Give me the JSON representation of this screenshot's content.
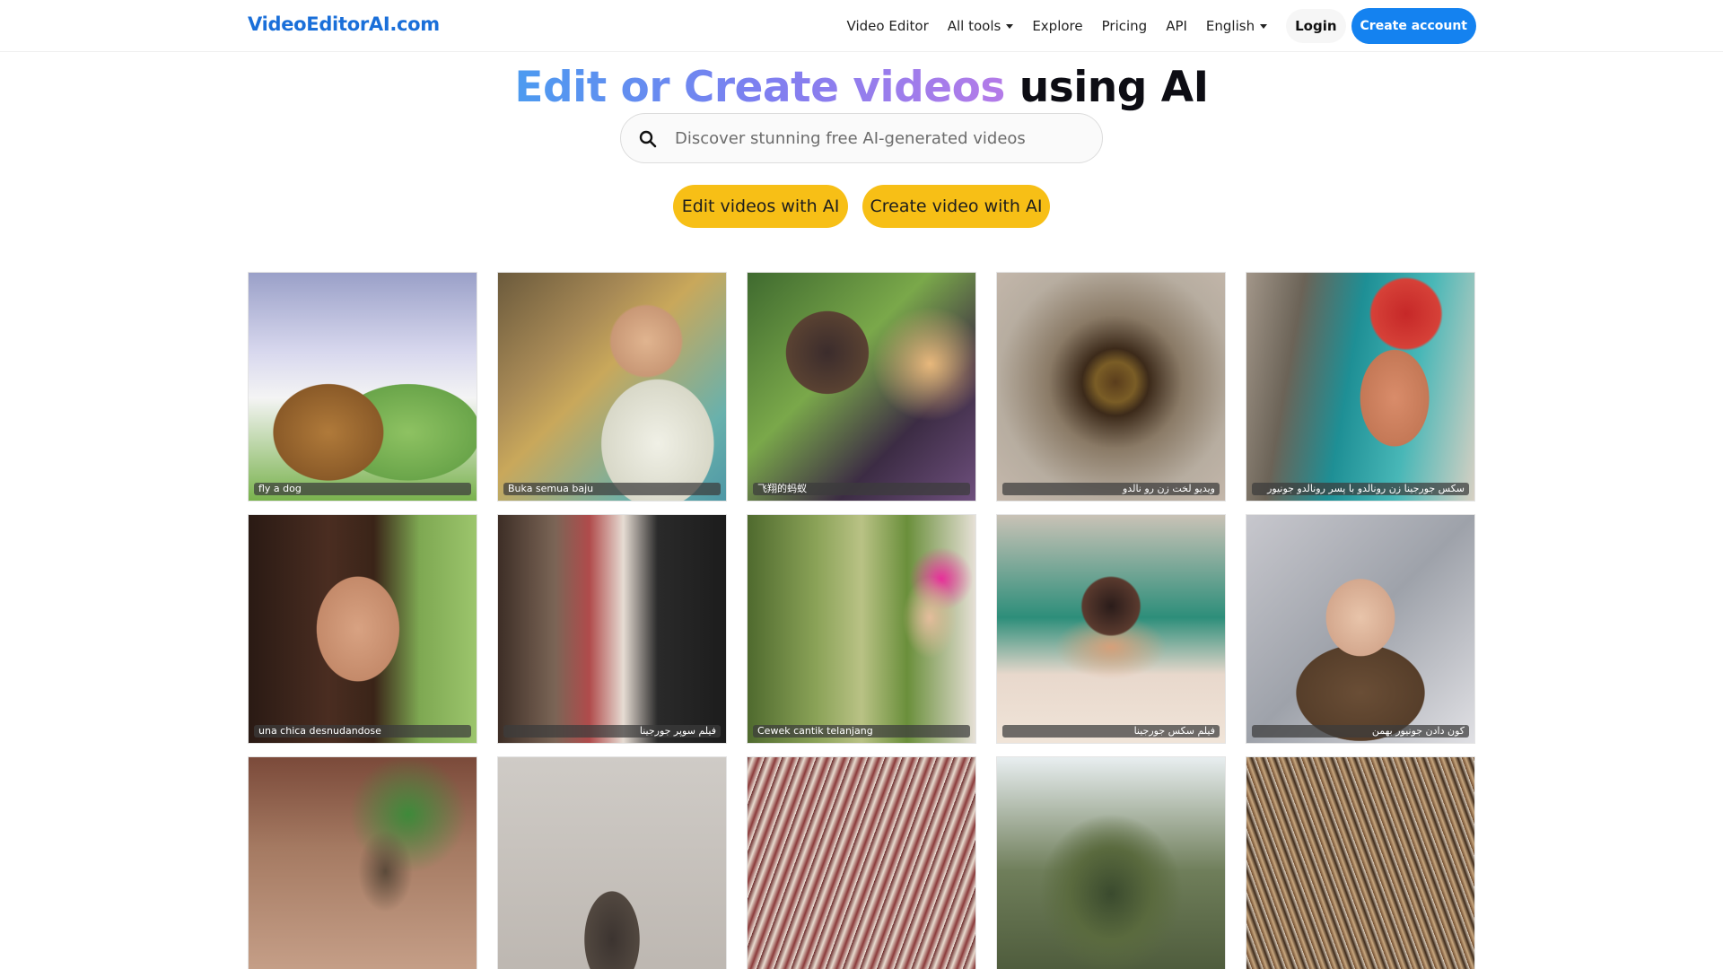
{
  "nav": {
    "brand": "VideoEditorAI.com",
    "video_editor": "Video Editor",
    "all_tools": "All tools",
    "explore": "Explore",
    "pricing": "Pricing",
    "api": "API",
    "language": "English",
    "login": "Login",
    "create_account": "Create account"
  },
  "hero": {
    "title_part1": "Edit or Create videos",
    "title_part2": " using AI"
  },
  "search": {
    "placeholder": "Discover stunning free AI-generated videos"
  },
  "cta": {
    "edit": "Edit videos with AI",
    "create": "Create video with AI"
  },
  "gallery": [
    {
      "caption": "fly a dog"
    },
    {
      "caption": "Buka semua baju"
    },
    {
      "caption": "飞翔的蚂蚁"
    },
    {
      "caption": "ویدیو لخت زن رو نالدو"
    },
    {
      "caption": "سکس جورجینا زن رونالدو با پسر رونالدو جونیور"
    },
    {
      "caption": "una chica desnudandose"
    },
    {
      "caption": "فیلم سوپر جورجینا"
    },
    {
      "caption": "Cewek cantik telanjang"
    },
    {
      "caption": "فیلم سکس جورجینا"
    },
    {
      "caption": "کون دادن جونیور بهمن"
    },
    {
      "caption": ""
    },
    {
      "caption": ""
    },
    {
      "caption": ""
    },
    {
      "caption": ""
    },
    {
      "caption": ""
    }
  ],
  "colors": {
    "brand": "#1a6fd9",
    "primary_button": "#1482f0",
    "cta": "#f7bf16"
  }
}
